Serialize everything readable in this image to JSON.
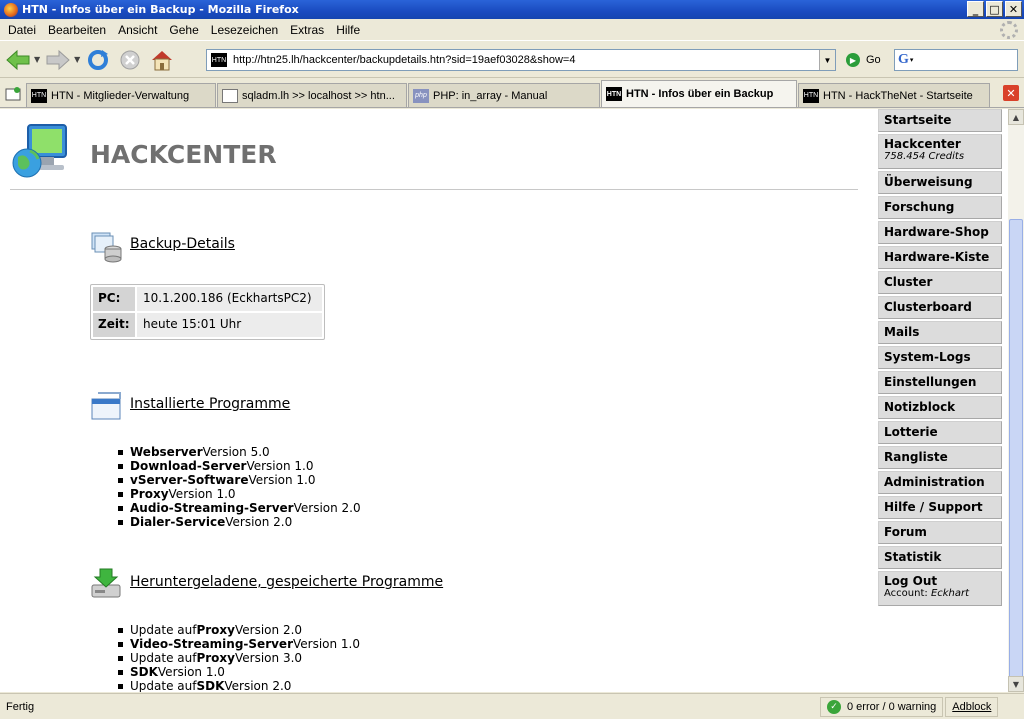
{
  "window": {
    "title": "HTN - Infos über ein Backup - Mozilla Firefox",
    "buttons": [
      "_",
      "□",
      "✕"
    ]
  },
  "menu": [
    "Datei",
    "Bearbeiten",
    "Ansicht",
    "Gehe",
    "Lesezeichen",
    "Extras",
    "Hilfe"
  ],
  "toolbar": {
    "url": "http://htn25.lh/hackcenter/backupdetails.htn?sid=19aef03028&show=4",
    "url_favicon": "HTN",
    "go_label": "Go",
    "search_engine": "G"
  },
  "tabs": [
    {
      "label": "HTN - Mitglieder-Verwaltung",
      "icon": "HTN",
      "active": false
    },
    {
      "label": "sqladm.lh >> localhost >> htn...",
      "icon": "",
      "active": false
    },
    {
      "label": "PHP: in_array - Manual",
      "icon": "php",
      "active": false
    },
    {
      "label": "HTN - Infos über ein Backup",
      "icon": "HTN",
      "active": true
    },
    {
      "label": "HTN - HackTheNet - Startseite",
      "icon": "HTN",
      "active": false
    }
  ],
  "page": {
    "brand": "HACKCENTER",
    "backup_section": {
      "title": "Backup-Details",
      "rows": [
        {
          "key": "PC:",
          "value": "10.1.200.186 (EckhartsPC2)"
        },
        {
          "key": "Zeit:",
          "value": "heute 15:01 Uhr"
        }
      ]
    },
    "installed_section": {
      "title": "Installierte Programme",
      "items": [
        {
          "prefix": "",
          "name": "Webserver",
          "suffix": " Version 5.0"
        },
        {
          "prefix": "",
          "name": "Download-Server",
          "suffix": " Version 1.0"
        },
        {
          "prefix": "",
          "name": "vServer-Software",
          "suffix": " Version 1.0"
        },
        {
          "prefix": "",
          "name": "Proxy",
          "suffix": " Version 1.0"
        },
        {
          "prefix": "",
          "name": "Audio-Streaming-Server",
          "suffix": " Version 2.0"
        },
        {
          "prefix": "",
          "name": "Dialer-Service",
          "suffix": " Version 2.0"
        }
      ]
    },
    "downloaded_section": {
      "title": "Heruntergeladene, gespeicherte Programme",
      "items": [
        {
          "prefix": "Update auf ",
          "name": "Proxy",
          "suffix": " Version 2.0"
        },
        {
          "prefix": "",
          "name": "Video-Streaming-Server",
          "suffix": " Version 1.0"
        },
        {
          "prefix": "Update auf ",
          "name": "Proxy",
          "suffix": " Version 3.0"
        },
        {
          "prefix": "",
          "name": "SDK",
          "suffix": " Version 1.0"
        },
        {
          "prefix": "Update auf ",
          "name": "SDK",
          "suffix": " Version 2.0"
        }
      ]
    }
  },
  "sidebar": {
    "items": [
      {
        "label": "Startseite"
      },
      {
        "label": "Hackcenter",
        "sub": "758.454 Credits"
      },
      {
        "label": "Überweisung"
      },
      {
        "label": "Forschung"
      },
      {
        "label": "Hardware-Shop"
      },
      {
        "label": "Hardware-Kiste"
      },
      {
        "label": "Cluster"
      },
      {
        "label": "Clusterboard"
      },
      {
        "label": "Mails"
      },
      {
        "label": "System-Logs"
      },
      {
        "label": "Einstellungen"
      },
      {
        "label": "Notizblock"
      },
      {
        "label": "Lotterie"
      },
      {
        "label": "Rangliste"
      },
      {
        "label": "Administration"
      },
      {
        "label": "Hilfe / Support"
      },
      {
        "label": "Forum"
      },
      {
        "label": "Statistik"
      },
      {
        "label": "Log Out",
        "sub_prefix": "Account: ",
        "sub_name": "Eckhart"
      }
    ]
  },
  "status": {
    "text": "Fertig",
    "validator": "0 error / 0 warning",
    "adblock": "Adblock"
  }
}
